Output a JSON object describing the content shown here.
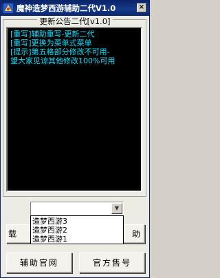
{
  "window": {
    "title": "魔神造梦西游辅助二代V1.0",
    "close_glyph": "×",
    "app_icon": "app-logo-icon"
  },
  "notice": {
    "caption": "更新公告二代[v1.0]",
    "lines": [
      "[重写]辅助重写-更新二代",
      "[重写]更换为菜单式菜单",
      "[提示]第五格部分修改不可用-",
      "望大家见谅其他修改100%可用"
    ],
    "text_color": "#00e0ff"
  },
  "game_select": {
    "value": "",
    "options": [
      "造梦西游3",
      "造梦西游2",
      "造梦西游1"
    ]
  },
  "buttons": {
    "left_partial": "载",
    "right_partial": "助",
    "official_site": "辅助官网",
    "official_shop": "官方售号"
  }
}
